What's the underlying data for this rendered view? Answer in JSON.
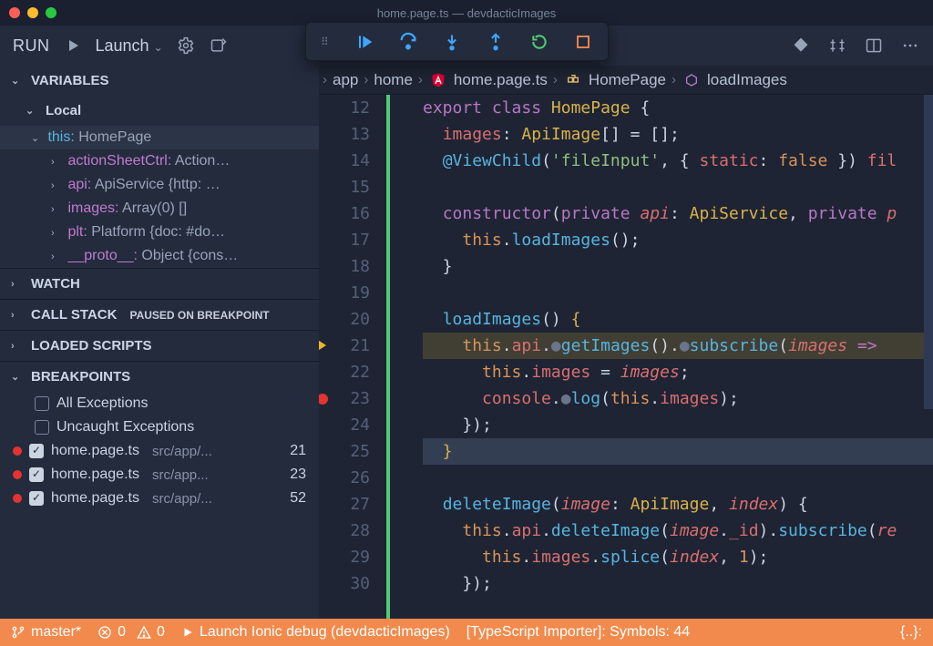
{
  "window": {
    "title": "home.page.ts — devdacticImages"
  },
  "runbar": {
    "label": "RUN",
    "config": "Launch"
  },
  "sections": {
    "variables": "VARIABLES",
    "local": "Local",
    "watch": "WATCH",
    "callstack": "CALL STACK",
    "callbadge": "PAUSED ON BREAKPOINT",
    "loaded": "LOADED SCRIPTS",
    "breakpoints": "BREAKPOINTS"
  },
  "vars": {
    "this_expr": "this:",
    "this_val": " HomePage",
    "items": [
      {
        "name": "actionSheetCtrl:",
        "val": " Action…"
      },
      {
        "name": "api:",
        "val": " ApiService {http: …"
      },
      {
        "name": "images:",
        "val": " Array(0) []"
      },
      {
        "name": "plt:",
        "val": " Platform {doc: #do…"
      },
      {
        "name": "__proto__:",
        "val": " Object {cons…"
      }
    ]
  },
  "bps": {
    "all": "All Exceptions",
    "uncaught": "Uncaught Exceptions",
    "rows": [
      {
        "file": "home.page.ts",
        "path": "src/app/...",
        "line": "21"
      },
      {
        "file": "home.page.ts",
        "path": "src/app...",
        "line": "23"
      },
      {
        "file": "home.page.ts",
        "path": "src/app/...",
        "line": "52"
      }
    ]
  },
  "breadcrumb": {
    "a": "app",
    "b": "home",
    "c": "home.page.ts",
    "d": "HomePage",
    "e": "loadImages"
  },
  "gutter": {
    "start": 12
  },
  "code": [
    {
      "n": 12,
      "seg": [
        [
          "p",
          "export "
        ],
        [
          "p",
          "class "
        ],
        [
          "y",
          "HomePage "
        ],
        [
          "w",
          "{"
        ]
      ]
    },
    {
      "n": 13,
      "seg": [
        [
          "w",
          "  "
        ],
        [
          "r",
          "images"
        ],
        [
          "w",
          ": "
        ],
        [
          "y",
          "ApiImage"
        ],
        [
          "w",
          "[] = [];"
        ]
      ]
    },
    {
      "n": 14,
      "seg": [
        [
          "w",
          "  "
        ],
        [
          "b",
          "@ViewChild"
        ],
        [
          "w",
          "("
        ],
        [
          "g",
          "'fileInput'"
        ],
        [
          "w",
          ", { "
        ],
        [
          "r",
          "static"
        ],
        [
          "w",
          ": "
        ],
        [
          "o",
          "false"
        ],
        [
          "w",
          " }) "
        ],
        [
          "r",
          "fil"
        ]
      ]
    },
    {
      "n": 15,
      "seg": [
        [
          "w",
          "  "
        ]
      ]
    },
    {
      "n": 16,
      "seg": [
        [
          "w",
          "  "
        ],
        [
          "p",
          "constructor"
        ],
        [
          "w",
          "("
        ],
        [
          "p",
          "private "
        ],
        [
          "i",
          "api"
        ],
        [
          "w",
          ": "
        ],
        [
          "y",
          "ApiService"
        ],
        [
          "w",
          ", "
        ],
        [
          "p",
          "private "
        ],
        [
          "i",
          "p"
        ]
      ]
    },
    {
      "n": 17,
      "seg": [
        [
          "w",
          "    "
        ],
        [
          "o",
          "this"
        ],
        [
          "w",
          "."
        ],
        [
          "b",
          "loadImages"
        ],
        [
          "w",
          "();"
        ]
      ]
    },
    {
      "n": 18,
      "seg": [
        [
          "w",
          "  }"
        ]
      ]
    },
    {
      "n": 19,
      "seg": [
        [
          "w",
          " "
        ]
      ]
    },
    {
      "n": 20,
      "seg": [
        [
          "w",
          "  "
        ],
        [
          "b",
          "loadImages"
        ],
        [
          "w",
          "() "
        ],
        [
          "y",
          "{"
        ]
      ]
    },
    {
      "n": 21,
      "hl": true,
      "seg": [
        [
          "w",
          "    "
        ],
        [
          "o",
          "this"
        ],
        [
          "w",
          "."
        ],
        [
          "r",
          "api"
        ],
        [
          "w",
          "."
        ],
        [
          "dim",
          "●"
        ],
        [
          "b",
          "getImages"
        ],
        [
          "w",
          "()."
        ],
        [
          "dim",
          "●"
        ],
        [
          "b",
          "subscribe"
        ],
        [
          "w",
          "("
        ],
        [
          "i",
          "images"
        ],
        [
          "w",
          " "
        ],
        [
          "p",
          "=>"
        ],
        [
          "w",
          " "
        ]
      ]
    },
    {
      "n": 22,
      "seg": [
        [
          "w",
          "      "
        ],
        [
          "o",
          "this"
        ],
        [
          "w",
          "."
        ],
        [
          "r",
          "images"
        ],
        [
          "w",
          " = "
        ],
        [
          "i",
          "images"
        ],
        [
          "w",
          ";"
        ]
      ]
    },
    {
      "n": 23,
      "seg": [
        [
          "w",
          "      "
        ],
        [
          "r",
          "console"
        ],
        [
          "w",
          "."
        ],
        [
          "dim",
          "●"
        ],
        [
          "b",
          "log"
        ],
        [
          "w",
          "("
        ],
        [
          "o",
          "this"
        ],
        [
          "w",
          "."
        ],
        [
          "r",
          "images"
        ],
        [
          "w",
          ");"
        ]
      ]
    },
    {
      "n": 24,
      "seg": [
        [
          "w",
          "    });"
        ]
      ]
    },
    {
      "n": 25,
      "cur": true,
      "seg": [
        [
          "y",
          "  }"
        ]
      ]
    },
    {
      "n": 26,
      "seg": [
        [
          "w",
          " "
        ]
      ]
    },
    {
      "n": 27,
      "seg": [
        [
          "w",
          "  "
        ],
        [
          "b",
          "deleteImage"
        ],
        [
          "w",
          "("
        ],
        [
          "i",
          "image"
        ],
        [
          "w",
          ": "
        ],
        [
          "y",
          "ApiImage"
        ],
        [
          "w",
          ", "
        ],
        [
          "i",
          "index"
        ],
        [
          "w",
          ") {"
        ]
      ]
    },
    {
      "n": 28,
      "seg": [
        [
          "w",
          "    "
        ],
        [
          "o",
          "this"
        ],
        [
          "w",
          "."
        ],
        [
          "r",
          "api"
        ],
        [
          "w",
          "."
        ],
        [
          "b",
          "deleteImage"
        ],
        [
          "w",
          "("
        ],
        [
          "i",
          "image"
        ],
        [
          "w",
          "."
        ],
        [
          "r",
          "_id"
        ],
        [
          "w",
          ")."
        ],
        [
          "b",
          "subscribe"
        ],
        [
          "w",
          "("
        ],
        [
          "i",
          "re"
        ]
      ]
    },
    {
      "n": 29,
      "seg": [
        [
          "w",
          "      "
        ],
        [
          "o",
          "this"
        ],
        [
          "w",
          "."
        ],
        [
          "r",
          "images"
        ],
        [
          "w",
          "."
        ],
        [
          "b",
          "splice"
        ],
        [
          "w",
          "("
        ],
        [
          "i",
          "index"
        ],
        [
          "w",
          ", "
        ],
        [
          "o",
          "1"
        ],
        [
          "w",
          ");"
        ]
      ]
    },
    {
      "n": 30,
      "seg": [
        [
          "w",
          "    });"
        ]
      ]
    }
  ],
  "status": {
    "branch": "master*",
    "errors": "0",
    "warnings": "0",
    "debug": "Launch Ionic debug (devdacticImages)",
    "importer": "[TypeScript Importer]: Symbols: 44",
    "prettier": "{..}:"
  }
}
